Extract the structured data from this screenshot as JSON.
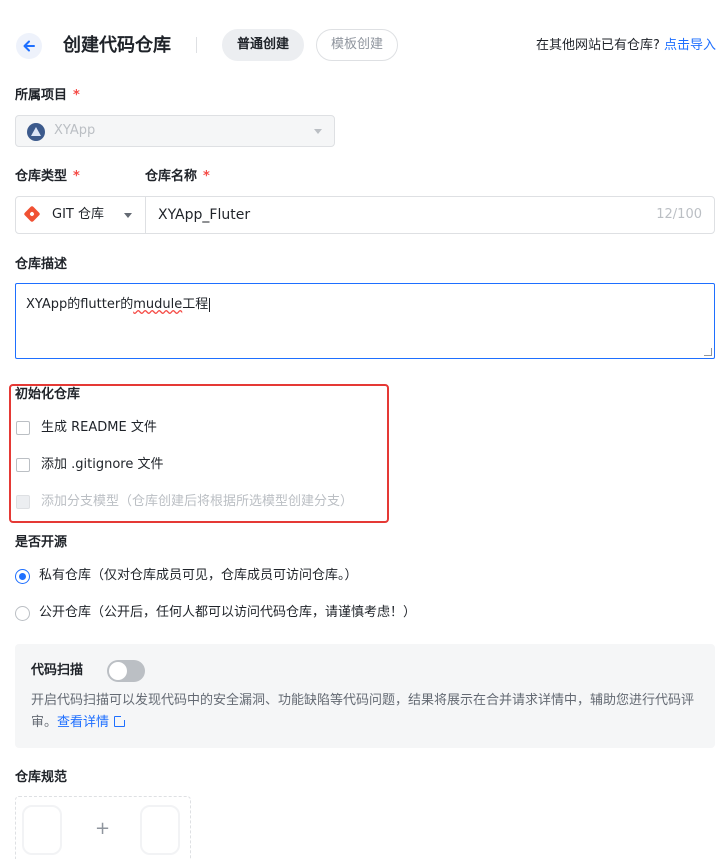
{
  "header": {
    "title": "创建代码仓库",
    "tabs": [
      "普通创建",
      "模板创建"
    ],
    "import_hint": "在其他网站已有仓库?",
    "import_link": "点击导入"
  },
  "project": {
    "label": "所属项目",
    "value": "XYApp"
  },
  "repo_type": {
    "label": "仓库类型",
    "value": "GIT 仓库"
  },
  "repo_name": {
    "label": "仓库名称",
    "value": "XYApp_Fluter",
    "counter": "12/100"
  },
  "description": {
    "label": "仓库描述",
    "value_pre": "XYApp的flutter的",
    "value_spell": "mudule",
    "value_post": "工程"
  },
  "init": {
    "label": "初始化仓库",
    "options": [
      {
        "label": "生成 README 文件",
        "checked": false,
        "disabled": false
      },
      {
        "label": "添加 .gitignore 文件",
        "checked": false,
        "disabled": false
      },
      {
        "label": "添加分支模型（仓库创建后将根据所选模型创建分支）",
        "checked": false,
        "disabled": true
      }
    ]
  },
  "visibility": {
    "label": "是否开源",
    "options": [
      {
        "label": "私有仓库（仅对仓库成员可见，仓库成员可访问仓库。）",
        "checked": true
      },
      {
        "label": "公开仓库（公开后，任何人都可以访问代码仓库，请谨慎考虑！）",
        "checked": false
      }
    ]
  },
  "code_scan": {
    "label": "代码扫描",
    "enabled": false,
    "description": "开启代码扫描可以发现代码中的安全漏洞、功能缺陷等代码问题，结果将展示在合并请求详情中，辅助您进行代码评审。",
    "link": "查看详情"
  },
  "repo_rules": {
    "label": "仓库规范",
    "add_symbol": "+"
  },
  "required_mark": "*",
  "colors": {
    "accent": "#1e6fff",
    "required": "#f54a45",
    "highlight_border": "#e53935"
  }
}
